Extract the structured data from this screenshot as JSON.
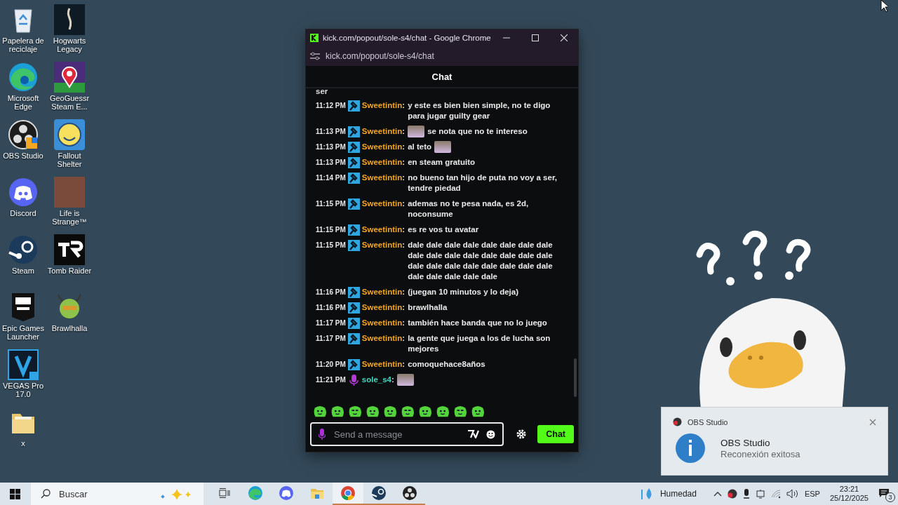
{
  "desktop_icons": [
    {
      "label": "Papelera de reciclaje",
      "kind": "bin"
    },
    {
      "label": "Microsoft Edge",
      "kind": "edge"
    },
    {
      "label": "OBS Studio",
      "kind": "obs"
    },
    {
      "label": "Discord",
      "kind": "discord"
    },
    {
      "label": "Steam",
      "kind": "steam"
    },
    {
      "label": "Epic Games Launcher",
      "kind": "epic"
    },
    {
      "label": "VEGAS Pro 17.0",
      "kind": "vegas"
    },
    {
      "label": "x",
      "kind": "folder"
    },
    {
      "label": "Hogwarts Legacy",
      "kind": "night"
    },
    {
      "label": "GeoGuessr Steam E...",
      "kind": "pin"
    },
    {
      "label": "Fallout Shelter",
      "kind": "mascot"
    },
    {
      "label": "Life is Strange™",
      "kind": "photo"
    },
    {
      "label": "Tomb Raider",
      "kind": "mono"
    },
    {
      "label": "Brawlhalla",
      "kind": "warrior"
    }
  ],
  "window": {
    "title": "kick.com/popout/sole-s4/chat - Google Chrome",
    "address": "kick.com/popout/sole-s4/chat"
  },
  "chat": {
    "header": "Chat",
    "cut_off_text": "ser",
    "messages": [
      {
        "time": "11:12 PM",
        "badge": {
          "kind": "moderator"
        },
        "user": "Sweetintin",
        "separator": ":",
        "color": "#f5a623",
        "parts": [
          {
            "kind": "text",
            "text": "y este es bien bien simple, no te digo para jugar guilty gear"
          }
        ]
      },
      {
        "time": "11:13 PM",
        "badge": {
          "kind": "moderator"
        },
        "user": "Sweetintin",
        "separator": ":",
        "color": "#f5a623",
        "parts": [
          {
            "kind": "emote"
          },
          {
            "kind": "text",
            "text": "se nota que no te intereso"
          }
        ]
      },
      {
        "time": "11:13 PM",
        "badge": {
          "kind": "moderator"
        },
        "user": "Sweetintin",
        "separator": ":",
        "color": "#f5a623",
        "parts": [
          {
            "kind": "text",
            "text": "al teto"
          },
          {
            "kind": "emote"
          }
        ]
      },
      {
        "time": "11:13 PM",
        "badge": {
          "kind": "moderator"
        },
        "user": "Sweetintin",
        "separator": ":",
        "color": "#f5a623",
        "parts": [
          {
            "kind": "text",
            "text": "en steam gratuito"
          }
        ]
      },
      {
        "time": "11:14 PM",
        "badge": {
          "kind": "moderator"
        },
        "user": "Sweetintin",
        "separator": ":",
        "color": "#f5a623",
        "parts": [
          {
            "kind": "text",
            "text": "no bueno tan hijo de puta no voy a ser, tendre piedad"
          }
        ]
      },
      {
        "time": "11:15 PM",
        "badge": {
          "kind": "moderator"
        },
        "user": "Sweetintin",
        "separator": ":",
        "color": "#f5a623",
        "parts": [
          {
            "kind": "text",
            "text": "ademas no te pesa nada, es 2d, noconsume"
          }
        ]
      },
      {
        "time": "11:15 PM",
        "badge": {
          "kind": "moderator"
        },
        "user": "Sweetintin",
        "separator": ":",
        "color": "#f5a623",
        "parts": [
          {
            "kind": "text",
            "text": "es re vos tu avatar"
          }
        ]
      },
      {
        "time": "11:15 PM",
        "badge": {
          "kind": "moderator"
        },
        "user": "Sweetintin",
        "separator": ":",
        "color": "#f5a623",
        "parts": [
          {
            "kind": "text",
            "text": "dale dale dale dale dale dale dale dale dale dale dale dale dale dale dale dale dale dale dale dale dale dale dale dale dale dale dale dale dale"
          }
        ]
      },
      {
        "time": "11:16 PM",
        "badge": {
          "kind": "moderator"
        },
        "user": "Sweetintin",
        "separator": ":",
        "color": "#f5a623",
        "parts": [
          {
            "kind": "text",
            "text": "(juegan 10 minutos y lo deja)"
          }
        ]
      },
      {
        "time": "11:16 PM",
        "badge": {
          "kind": "moderator"
        },
        "user": "Sweetintin",
        "separator": ":",
        "color": "#f5a623",
        "parts": [
          {
            "kind": "text",
            "text": "brawlhalla"
          }
        ]
      },
      {
        "time": "11:17 PM",
        "badge": {
          "kind": "moderator"
        },
        "user": "Sweetintin",
        "separator": ":",
        "color": "#f5a623",
        "parts": [
          {
            "kind": "text",
            "text": "también hace banda que no lo juego"
          }
        ]
      },
      {
        "time": "11:17 PM",
        "badge": {
          "kind": "moderator"
        },
        "user": "Sweetintin",
        "separator": ":",
        "color": "#f5a623",
        "parts": [
          {
            "kind": "text",
            "text": "la gente que juega a los de lucha son mejores"
          }
        ]
      },
      {
        "time": "11:20 PM",
        "badge": {
          "kind": "moderator"
        },
        "user": "Sweetintin",
        "separator": ":",
        "color": "#f5a623",
        "parts": [
          {
            "kind": "text",
            "text": "comoquehace8años"
          }
        ]
      },
      {
        "time": "11:21 PM",
        "badge": {
          "kind": "broadcaster"
        },
        "user": "sole_s4",
        "separator": ":",
        "color": "#3fd9c0",
        "parts": [
          {
            "kind": "emote"
          }
        ]
      }
    ],
    "input": {
      "placeholder": "Send a message"
    },
    "send_button": "Chat"
  },
  "notification": {
    "app": "OBS Studio",
    "title": "OBS Studio",
    "body": "Reconexión exitosa"
  },
  "taskbar": {
    "search": {
      "placeholder": "Buscar"
    },
    "apps": [
      {
        "kind": "edge",
        "running": false,
        "selected": false
      },
      {
        "kind": "discord",
        "running": false,
        "selected": false
      },
      {
        "kind": "folder",
        "running": false,
        "selected": false
      },
      {
        "kind": "chrome",
        "running": true,
        "selected": true
      },
      {
        "kind": "steam",
        "running": true,
        "selected": false
      },
      {
        "kind": "obs",
        "running": true,
        "selected": false
      }
    ],
    "weather": "Humedad",
    "language": "ESP",
    "time": "23:21",
    "date": "25/12/2025",
    "notification_count": "3"
  }
}
